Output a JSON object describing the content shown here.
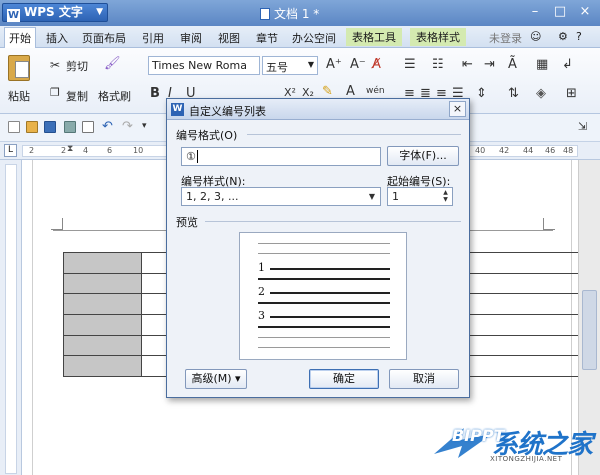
{
  "app": {
    "name": "WPS 文字",
    "doc_title": "文档 1 *"
  },
  "window_controls": [
    "–",
    "□",
    "×"
  ],
  "menubar": {
    "items": [
      "开始",
      "插入",
      "页面布局",
      "引用",
      "审阅",
      "视图",
      "章节",
      "办公空间",
      "表格工具",
      "表格样式"
    ],
    "login": "未登录",
    "help": "?"
  },
  "ribbon": {
    "paste": "粘贴",
    "cut": "剪切",
    "copy": "复制",
    "format_painter": "格式刷",
    "font_name": "Times New Roma",
    "font_size": "五号",
    "bold": "B",
    "italic": "I",
    "underline": "U"
  },
  "ruler": {
    "marks": [
      "2",
      "2",
      "4",
      "6",
      "10",
      "40",
      "42",
      "44",
      "46",
      "48"
    ],
    "tab_symbol": "L"
  },
  "dialog": {
    "title": "自定义编号列表",
    "close": "×",
    "number_format_label": "编号格式(O)",
    "number_format_value": "①",
    "font_button": "字体(F)...",
    "number_style_label": "编号样式(N):",
    "number_style_value": "1, 2, 3, ...",
    "start_at_label": "起始编号(S):",
    "start_at_value": "1",
    "preview_label": "预览",
    "preview_numbers": [
      "1",
      "2",
      "3"
    ],
    "advanced_button": "高级(M) ▾",
    "ok_button": "确定",
    "cancel_button": "取消"
  },
  "watermark": {
    "text": "系统之家",
    "sub": "XITONGZHIJIA.NET",
    "logo_text": "BIPPT"
  },
  "colors": {
    "titlebar": "#5b86c4",
    "highlight": "#d9322f",
    "table_shade": "#c6c6c6"
  }
}
